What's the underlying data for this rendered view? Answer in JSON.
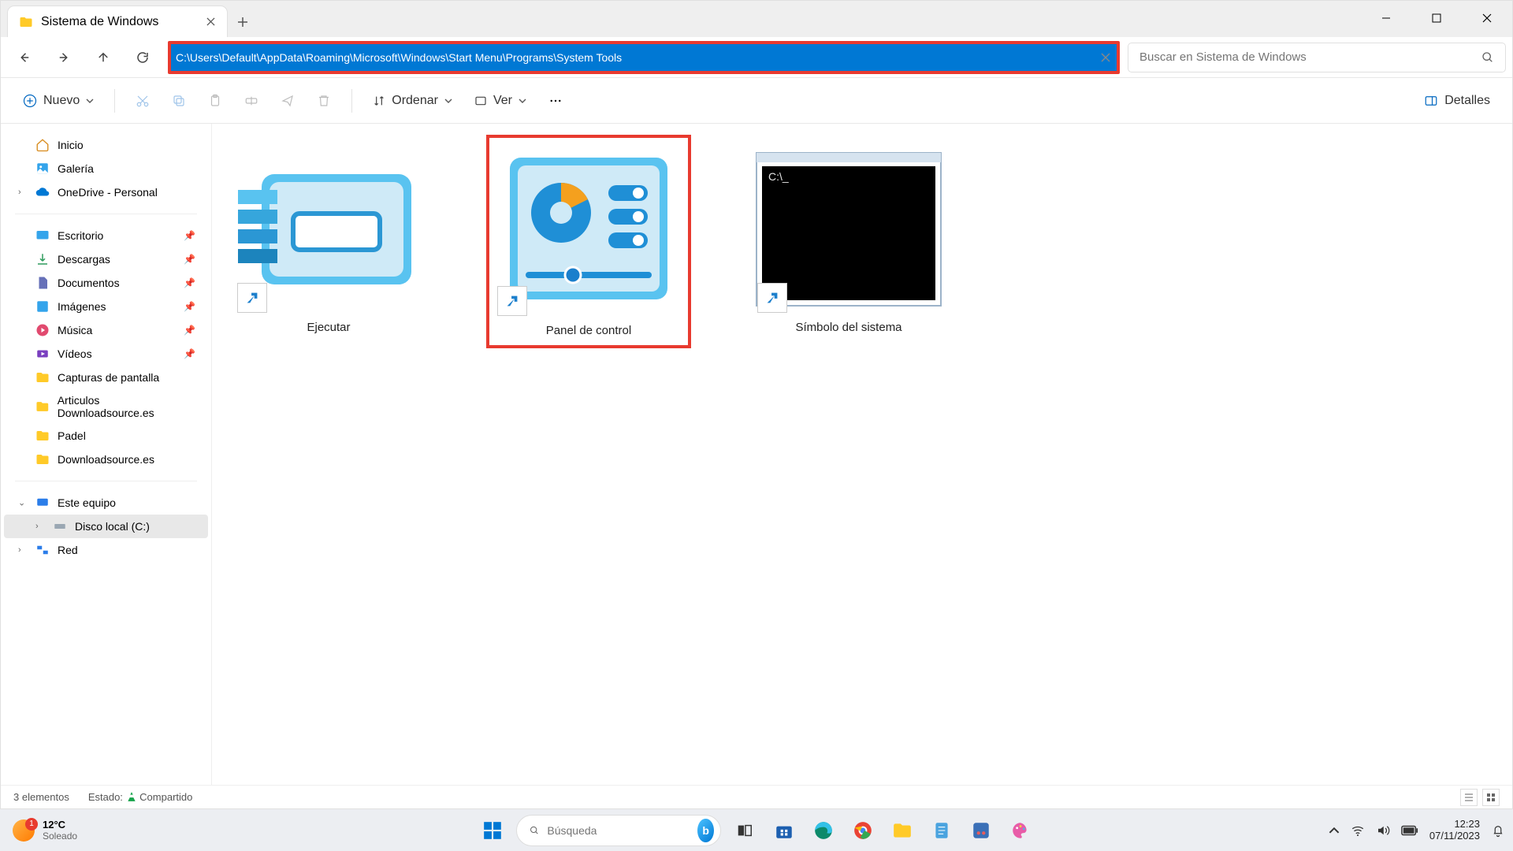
{
  "tab": {
    "title": "Sistema de Windows"
  },
  "address": {
    "path": "C:\\Users\\Default\\AppData\\Roaming\\Microsoft\\Windows\\Start Menu\\Programs\\System Tools"
  },
  "search": {
    "placeholder": "Buscar en Sistema de Windows"
  },
  "toolbar": {
    "new": "Nuevo",
    "sort": "Ordenar",
    "view": "Ver",
    "details": "Detalles"
  },
  "sidebar": {
    "top": [
      {
        "label": "Inicio"
      },
      {
        "label": "Galería"
      },
      {
        "label": "OneDrive - Personal"
      }
    ],
    "pinned": [
      {
        "label": "Escritorio"
      },
      {
        "label": "Descargas"
      },
      {
        "label": "Documentos"
      },
      {
        "label": "Imágenes"
      },
      {
        "label": "Música"
      },
      {
        "label": "Vídeos"
      },
      {
        "label": "Capturas de pantalla"
      },
      {
        "label": "Articulos Downloadsource.es"
      },
      {
        "label": "Padel"
      },
      {
        "label": "Downloadsource.es"
      }
    ],
    "system": [
      {
        "label": "Este equipo"
      },
      {
        "label": "Disco local (C:)"
      },
      {
        "label": "Red"
      }
    ]
  },
  "items": [
    {
      "label": "Ejecutar"
    },
    {
      "label": "Panel de control"
    },
    {
      "label": "Símbolo del sistema"
    }
  ],
  "status": {
    "count": "3 elementos",
    "state_label": "Estado:",
    "shared": "Compartido"
  },
  "weather": {
    "temp": "12°C",
    "cond": "Soleado"
  },
  "taskbar_search": {
    "placeholder": "Búsqueda"
  },
  "clock": {
    "time": "12:23",
    "date": "07/11/2023"
  }
}
